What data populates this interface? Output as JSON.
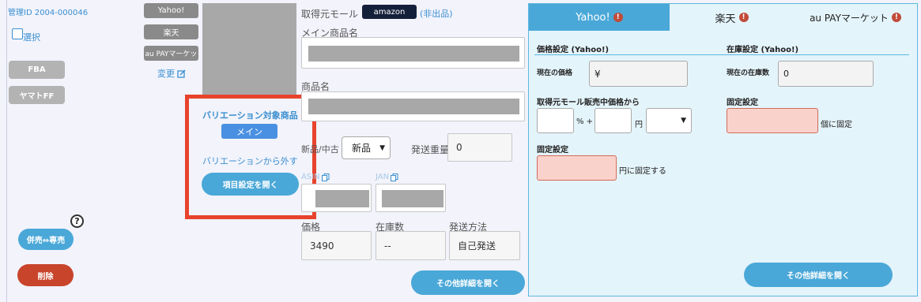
{
  "left": {
    "management_id": "管理ID 2004-000046",
    "select_label": "選択",
    "fba_label": "FBA",
    "yamato_label": "ヤマトFF",
    "help_icon": "question-circle-icon",
    "toggle_label": "併売⇔専売",
    "delete_label": "削除"
  },
  "malls": {
    "yahoo": "Yahoo!",
    "rakuten": "楽天",
    "aupay": "au PAYマーケッ",
    "change_label": "変更",
    "change_icon": "edit-icon"
  },
  "variation": {
    "title": "バリエーション対象商品",
    "main_badge": "メイン",
    "remove_label": "バリエーションから外す",
    "open_settings": "項目設定を開く"
  },
  "product": {
    "source_mall_label": "取得元モール",
    "source_mall": "amazon",
    "not_listed": "(非出品)",
    "main_name_label": "メイン商品名",
    "name_label": "商品名",
    "condition_label_a": "新品",
    "condition_label_b": "中古",
    "condition_value": "新品",
    "weight_label": "発送重量",
    "weight_value": "0",
    "asin_label": "ASIN",
    "jan_label": "JAN",
    "copy_icon": "copy-icon",
    "price_label": "価格",
    "price_value": "3490",
    "stock_label": "在庫数",
    "stock_value": "--",
    "shipping_label": "発送方法",
    "shipping_value": "自己発送",
    "other_details": "その他詳細を開く"
  },
  "panel": {
    "tabs": [
      {
        "label": "Yahoo!",
        "icon": "warning-icon"
      },
      {
        "label": "楽天",
        "icon": "warning-icon"
      },
      {
        "label": "au PAYマーケット",
        "icon": "warning-icon"
      }
    ],
    "price_setting": "価格設定 (Yahoo!)",
    "stock_setting": "在庫設定 (Yahoo!)",
    "current_price_label": "現在の価格",
    "current_price_value": "¥",
    "current_stock_label": "現在の在庫数",
    "current_stock_value": "0",
    "from_source_label": "取得元モール販売中価格から",
    "percent_plus": "% +",
    "yen": "円",
    "fixed_label": "固定設定",
    "fixed_stock_suffix": "個に固定",
    "fixed_price_label": "固定設定",
    "fixed_price_suffix": "円に固定する",
    "other_details": "その他詳細を開く"
  },
  "colors": {
    "accent": "#4aa8d8",
    "highlight_red": "#e8432c",
    "delete_red": "#c8442a",
    "main_badge": "#4a90e2"
  }
}
